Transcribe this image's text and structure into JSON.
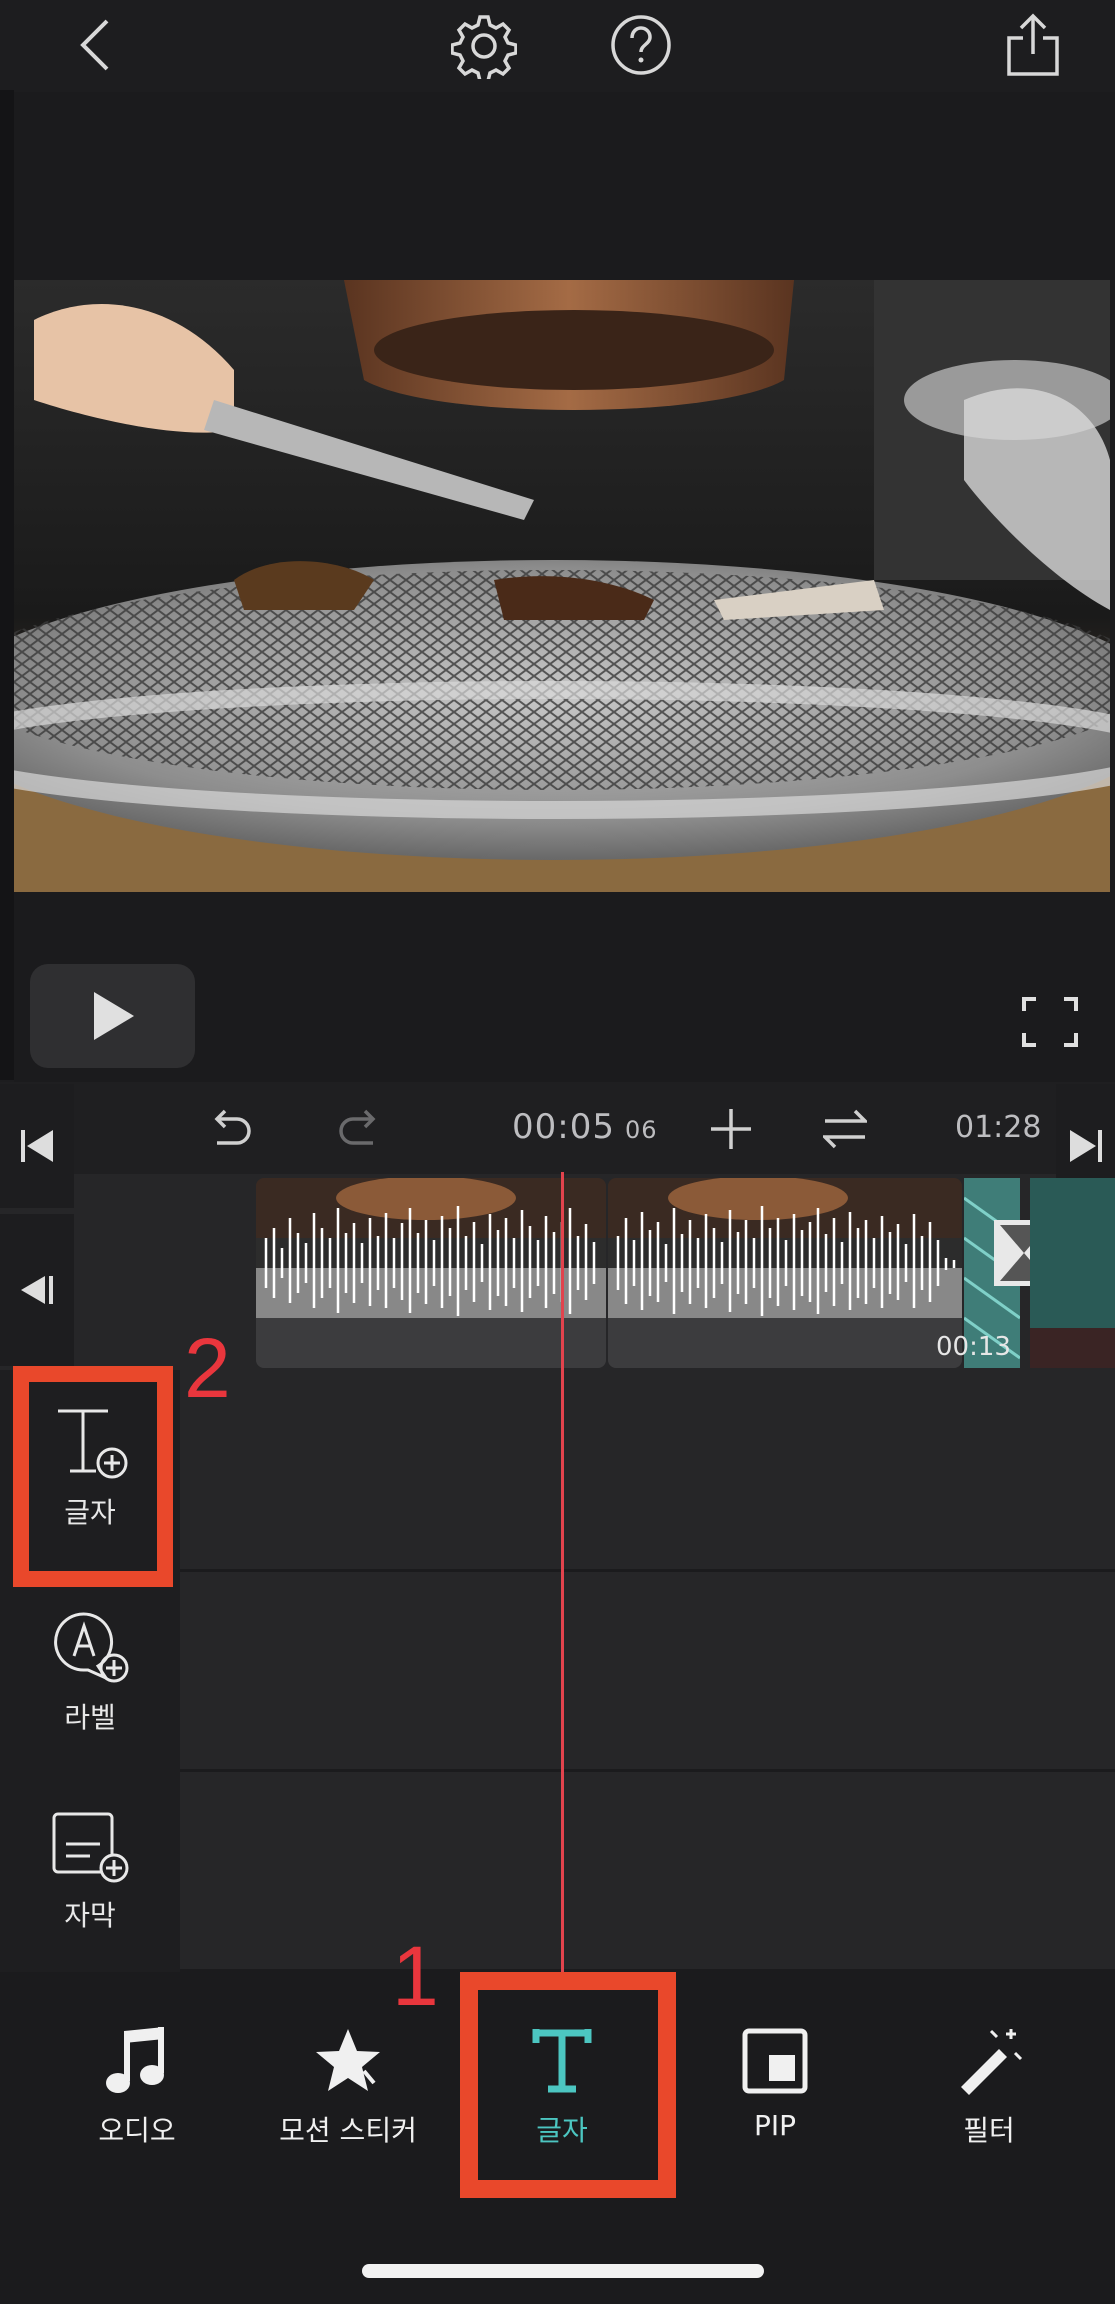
{
  "topbar": {
    "back_icon": "chevron-left-icon",
    "settings_icon": "gear-icon",
    "help_icon": "question-circle-icon",
    "share_icon": "share-icon"
  },
  "player": {
    "play_icon": "play-icon",
    "fullscreen_icon": "fullscreen-icon"
  },
  "timeline": {
    "current_time": "00:05",
    "current_frame": "06",
    "total_duration": "01:28",
    "clip_duration": "00:13"
  },
  "track_tools": [
    {
      "label": "글자",
      "icon": "text-add-icon"
    },
    {
      "label": "라벨",
      "icon": "label-add-icon"
    },
    {
      "label": "자막",
      "icon": "subtitle-add-icon"
    }
  ],
  "toolbar": {
    "items": [
      {
        "label": "오디오",
        "icon": "music-note-icon"
      },
      {
        "label": "모션 스티커",
        "icon": "star-icon"
      },
      {
        "label": "글자",
        "icon": "text-icon"
      },
      {
        "label": "PIP",
        "icon": "pip-icon"
      },
      {
        "label": "필터",
        "icon": "magic-wand-icon"
      }
    ],
    "active_index": 2
  },
  "annotations": {
    "step1": "1",
    "step2": "2"
  },
  "colors": {
    "accent": "#4cc6c1",
    "playhead": "#e2434d",
    "annotation": "#e9482b"
  }
}
